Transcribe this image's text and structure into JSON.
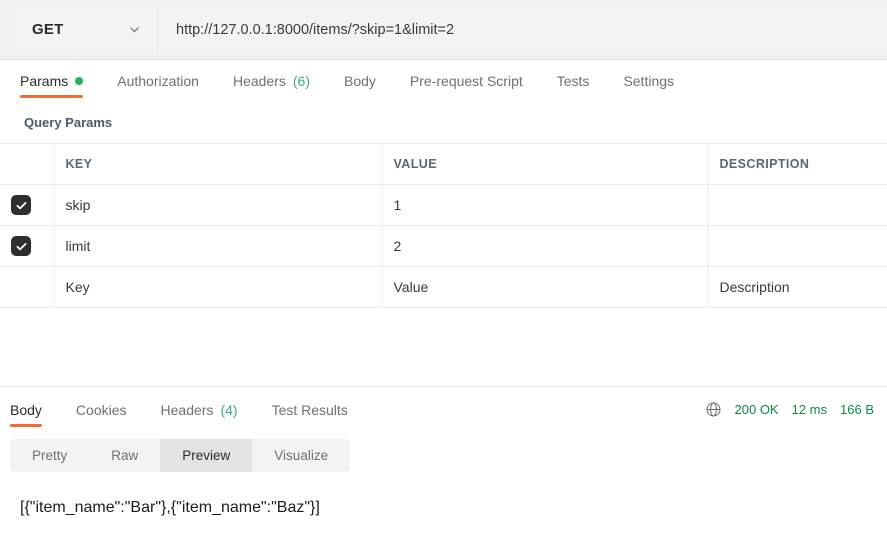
{
  "request": {
    "method": "GET",
    "method_icon": "chevron-down-icon",
    "url": "http://127.0.0.1:8000/items/?skip=1&limit=2",
    "url_placeholder": "Enter request URL",
    "tabs": [
      {
        "label": "Params",
        "count": "",
        "badge": "dot",
        "active": true
      },
      {
        "label": "Authorization",
        "count": "",
        "badge": "",
        "active": false
      },
      {
        "label": "Headers",
        "count": "(6)",
        "badge": "",
        "active": false
      },
      {
        "label": "Body",
        "count": "",
        "badge": "",
        "active": false
      },
      {
        "label": "Pre-request Script",
        "count": "",
        "badge": "",
        "active": false
      },
      {
        "label": "Tests",
        "count": "",
        "badge": "",
        "active": false
      },
      {
        "label": "Settings",
        "count": "",
        "badge": "",
        "active": false
      }
    ],
    "params": {
      "title": "Query Params",
      "columns": [
        "KEY",
        "VALUE",
        "DESCRIPTION"
      ],
      "rows": [
        {
          "checked": true,
          "key": "skip",
          "value": "1",
          "description": ""
        },
        {
          "checked": true,
          "key": "limit",
          "value": "2",
          "description": ""
        }
      ],
      "placeholder_row": {
        "key": "Key",
        "value": "Value",
        "description": "Description"
      }
    }
  },
  "response": {
    "tabs": [
      {
        "label": "Body",
        "count": "",
        "active": true
      },
      {
        "label": "Cookies",
        "count": "",
        "active": false
      },
      {
        "label": "Headers",
        "count": "(4)",
        "active": false
      },
      {
        "label": "Test Results",
        "count": "",
        "active": false
      }
    ],
    "status": {
      "icon": "globe-icon",
      "code": "200 OK",
      "time": "12 ms",
      "size": "166 B",
      "color": "#0e8a45"
    },
    "views": [
      {
        "label": "Pretty",
        "active": false
      },
      {
        "label": "Raw",
        "active": false
      },
      {
        "label": "Preview",
        "active": true
      },
      {
        "label": "Visualize",
        "active": false
      }
    ],
    "body": "[{\"item_name\":\"Bar\"},{\"item_name\":\"Baz\"}]"
  },
  "colors": {
    "accent": "#ef6c34",
    "success": "#0e8a45",
    "dot": "#22b559",
    "count": "#3aab7d"
  }
}
